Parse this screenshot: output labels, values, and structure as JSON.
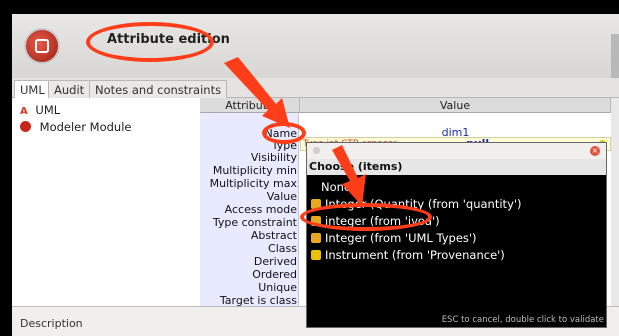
{
  "header": {
    "title": "Attribute edition"
  },
  "tabs": [
    "UML",
    "Audit",
    "Notes and constraints"
  ],
  "tree": [
    "UML",
    "Modeler Module"
  ],
  "table": {
    "col_attribute": "Attribute",
    "col_value": "Value",
    "rows": [
      {
        "label": "Name",
        "value": "dim1"
      },
      {
        "label": "Type",
        "value": "null"
      },
      {
        "label": "Visibility",
        "value": ""
      },
      {
        "label": "Multiplicity min",
        "value": ""
      },
      {
        "label": "Multiplicity max",
        "value": ""
      },
      {
        "label": "Value",
        "value": ""
      },
      {
        "label": "Access mode",
        "value": ""
      },
      {
        "label": "Type constraint",
        "value": ""
      },
      {
        "label": "Abstract",
        "value": ""
      },
      {
        "label": "Class",
        "value": ""
      },
      {
        "label": "Derived",
        "value": ""
      },
      {
        "label": "Ordered",
        "value": ""
      },
      {
        "label": "Unique",
        "value": ""
      },
      {
        "label": "Target is class",
        "value": ""
      }
    ],
    "type_hint": "Type int CTR<space>"
  },
  "popup": {
    "title": "Choose (items)",
    "options": [
      "None",
      "Integer (Quantity (from 'quantity')",
      "integer (from 'ivoa')",
      "Integer (from 'UML Types')",
      "Instrument (from 'Provenance')"
    ],
    "footer": "ESC to cancel, double click to validate"
  },
  "description": {
    "label": "Description"
  },
  "colors": {
    "annotation": "#ff3d18",
    "value_blue": "#1a2aa8"
  }
}
